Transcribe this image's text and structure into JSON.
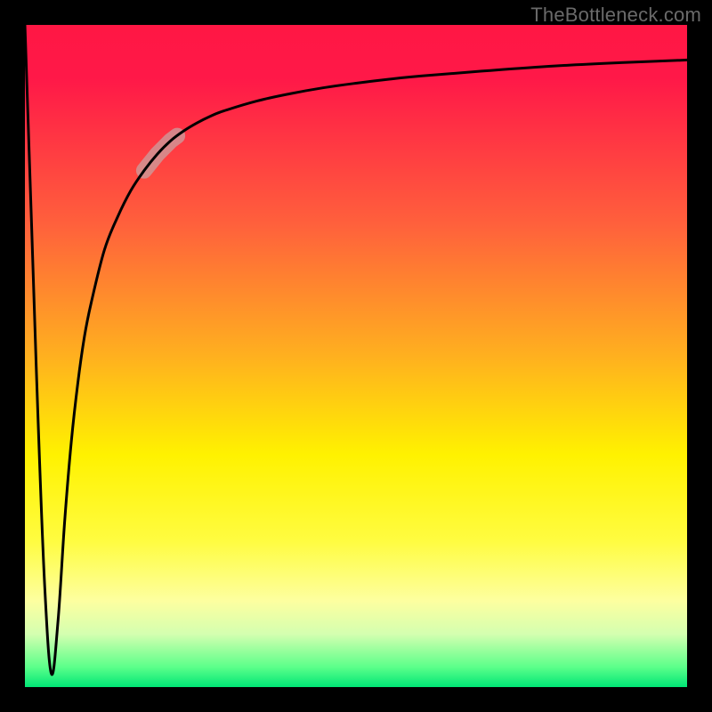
{
  "watermark": "TheBottleneck.com",
  "chart_data": {
    "type": "line",
    "title": "",
    "xlabel": "",
    "ylabel": "",
    "xlim": [
      0,
      100
    ],
    "ylim": [
      0,
      100
    ],
    "grid": false,
    "legend": false,
    "description": "Single black curve plunging from 100% to a minimum near x≈4 then recovering asymptotically toward ~95% over a red→yellow→green vertical gradient background. A thick semi-transparent segment highlights the curve around x≈18–23.",
    "series": [
      {
        "name": "curve",
        "x": [
          0,
          1,
          2,
          3,
          4,
          5,
          6,
          7,
          8,
          9,
          10,
          12,
          14,
          16,
          18,
          20,
          22,
          24,
          26,
          28,
          30,
          35,
          40,
          45,
          50,
          55,
          60,
          70,
          80,
          90,
          100
        ],
        "y": [
          100,
          70,
          40,
          15,
          2,
          10,
          25,
          37,
          46,
          53,
          58,
          66,
          71,
          75,
          78,
          80.5,
          82.5,
          84,
          85.2,
          86.2,
          87,
          88.5,
          89.6,
          90.5,
          91.2,
          91.8,
          92.3,
          93.1,
          93.8,
          94.3,
          94.7
        ]
      }
    ],
    "highlight_segment": {
      "x_start": 18,
      "x_end": 23
    },
    "gradient_stops": [
      {
        "offset": 0.0,
        "color": "#ff1744"
      },
      {
        "offset": 0.08,
        "color": "#ff1848"
      },
      {
        "offset": 0.3,
        "color": "#ff603c"
      },
      {
        "offset": 0.5,
        "color": "#ffb01f"
      },
      {
        "offset": 0.65,
        "color": "#fff200"
      },
      {
        "offset": 0.78,
        "color": "#fffc41"
      },
      {
        "offset": 0.87,
        "color": "#fdffa0"
      },
      {
        "offset": 0.92,
        "color": "#d4ffb0"
      },
      {
        "offset": 0.97,
        "color": "#5bff8a"
      },
      {
        "offset": 1.0,
        "color": "#00e676"
      }
    ]
  }
}
